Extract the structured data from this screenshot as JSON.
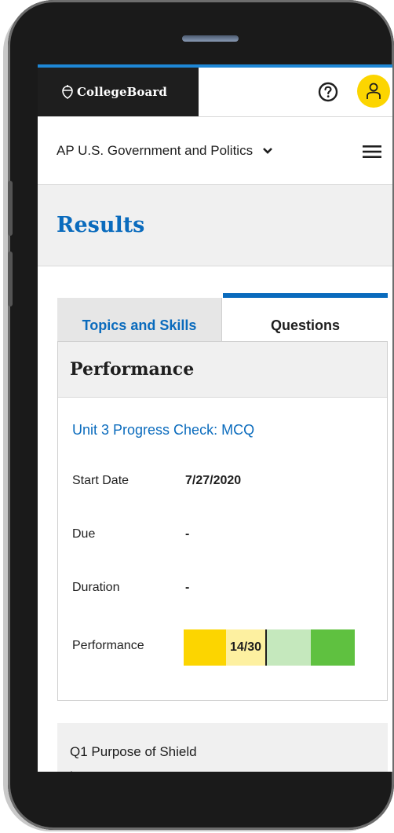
{
  "header": {
    "logo_text": "CollegeBoard"
  },
  "subheader": {
    "course_name": "AP U.S. Government and Politics"
  },
  "page": {
    "title": "Results"
  },
  "tabs": [
    {
      "label": "Topics and Skills",
      "active": false
    },
    {
      "label": "Questions",
      "active": true
    }
  ],
  "performance_card": {
    "title": "Performance",
    "assignment_link": "Unit 3 Progress Check: MCQ",
    "rows": [
      {
        "label": "Start Date",
        "value": "7/27/2020"
      },
      {
        "label": "Due",
        "value": "-"
      },
      {
        "label": "Duration",
        "value": "-"
      },
      {
        "label": "Performance",
        "value": ""
      }
    ],
    "score": "14/30",
    "score_fraction": 0.4667
  },
  "next_card": {
    "title": "Q1 Purpose of Shield",
    "subtitle": "I"
  },
  "colors": {
    "brand_blue": "#0a6bbd",
    "accent_yellow": "#fcd500",
    "header_dark": "#1e1e1e",
    "bar_light_yellow": "#fdf0a0",
    "bar_light_green": "#c5e8bd",
    "bar_green": "#5fc140"
  },
  "icons": [
    "acorn-logo-icon",
    "help-icon",
    "user-icon",
    "chevron-down-icon",
    "hamburger-menu-icon"
  ]
}
